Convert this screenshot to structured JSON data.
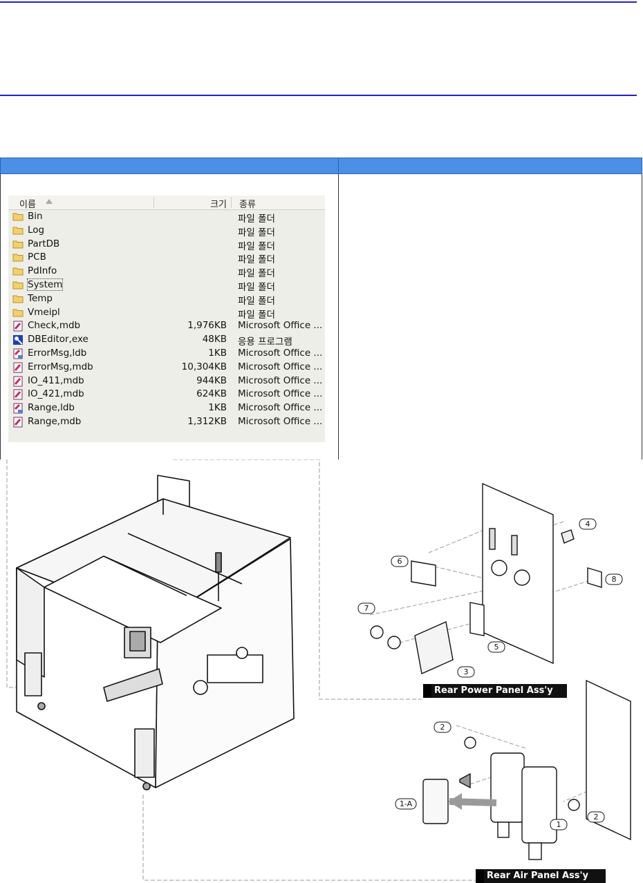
{
  "explorer": {
    "columns": {
      "name": "이름",
      "size": "크기",
      "type": "종류"
    },
    "rows": [
      {
        "name": "Bin",
        "size": "",
        "type": "파일 폴더",
        "icon": "folder-icon"
      },
      {
        "name": "Log",
        "size": "",
        "type": "파일 폴더",
        "icon": "folder-icon"
      },
      {
        "name": "PartDB",
        "size": "",
        "type": "파일 폴더",
        "icon": "folder-icon"
      },
      {
        "name": "PCB",
        "size": "",
        "type": "파일 폴더",
        "icon": "folder-icon"
      },
      {
        "name": "PdInfo",
        "size": "",
        "type": "파일 폴더",
        "icon": "folder-icon"
      },
      {
        "name": "System",
        "size": "",
        "type": "파일 폴더",
        "icon": "folder-icon"
      },
      {
        "name": "Temp",
        "size": "",
        "type": "파일 폴더",
        "icon": "folder-icon"
      },
      {
        "name": "Vmeipl",
        "size": "",
        "type": "파일 폴더",
        "icon": "folder-icon"
      },
      {
        "name": "Check,mdb",
        "size": "1,976KB",
        "type": "Microsoft Office ...",
        "icon": "access-db-icon"
      },
      {
        "name": "DBEditor,exe",
        "size": "48KB",
        "type": "응용 프로그램",
        "icon": "application-icon"
      },
      {
        "name": "ErrorMsg,ldb",
        "size": "1KB",
        "type": "Microsoft Office ...",
        "icon": "access-lock-icon"
      },
      {
        "name": "ErrorMsg,mdb",
        "size": "10,304KB",
        "type": "Microsoft Office ...",
        "icon": "access-db-icon"
      },
      {
        "name": "IO_411,mdb",
        "size": "944KB",
        "type": "Microsoft Office ...",
        "icon": "access-db-icon"
      },
      {
        "name": "IO_421,mdb",
        "size": "624KB",
        "type": "Microsoft Office ...",
        "icon": "access-db-icon"
      },
      {
        "name": "Range,ldb",
        "size": "1KB",
        "type": "Microsoft Office ...",
        "icon": "access-lock-icon"
      },
      {
        "name": "Range,mdb",
        "size": "1,312KB",
        "type": "Microsoft Office ...",
        "icon": "access-db-icon"
      }
    ]
  },
  "figure": {
    "power_caption": "Rear  Power  Panel  Ass'y",
    "air_caption": "Rear  Air  Panel  Ass'y",
    "callouts": [
      "4",
      "6",
      "8",
      "7",
      "5",
      "3",
      "2",
      "2",
      "1-A",
      "1"
    ]
  },
  "colors": {
    "rule": "#1f1fd0",
    "table_header": "#4d8fe6"
  }
}
